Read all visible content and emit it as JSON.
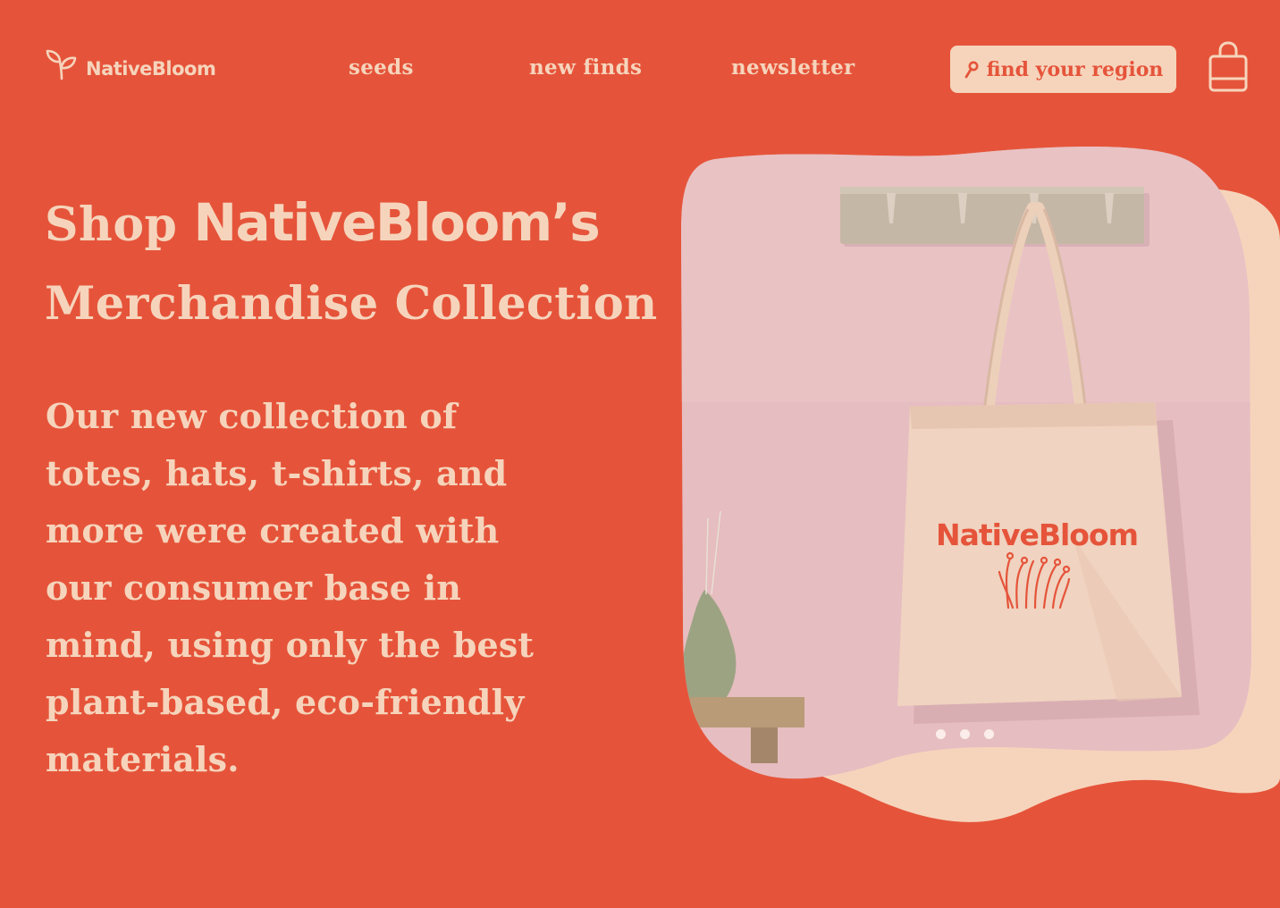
{
  "brand": {
    "name": "NativeBloom",
    "logo_icon": "sprout-icon"
  },
  "nav": {
    "items": [
      {
        "label": "seeds"
      },
      {
        "label": "new finds"
      },
      {
        "label": "newsletter"
      }
    ],
    "region_button": {
      "label": "find your region",
      "icon": "pin-icon"
    },
    "cart_icon": "shopping-bag-icon"
  },
  "hero": {
    "title_prefix": "Shop",
    "title_brand": "NativeBloom’s",
    "title_line2": "Merchandise Collection",
    "description": "Our new collection of totes, hats, t-shirts, and more were created with our consumer base in mind, using only the best plant-based, eco-friendly materials.",
    "image": {
      "tote_print": "NativeBloom",
      "carousel_slide_count": 3
    }
  },
  "colors": {
    "background": "#E5543A",
    "cream": "#F6D4BC",
    "blob_pink": "#DFB4BA",
    "wall_pink": "#E6BDC0"
  }
}
